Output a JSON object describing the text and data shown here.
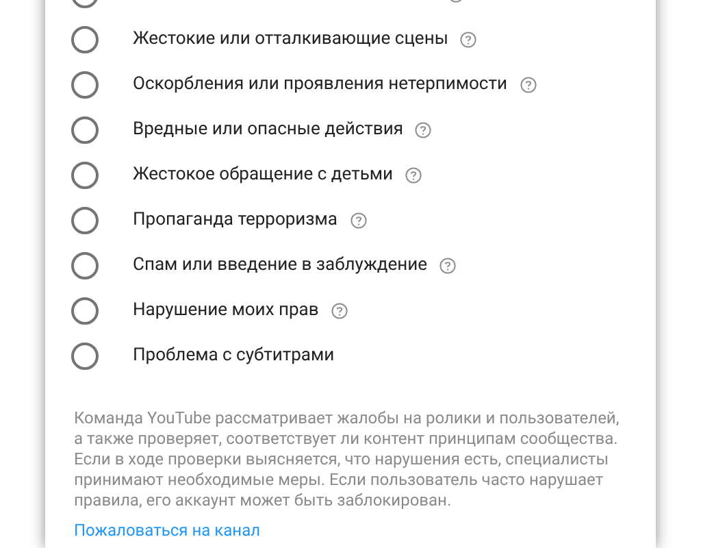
{
  "options": [
    {
      "selected": false,
      "help": true
    },
    {
      "label": "Жестокие или отталкивающие сцены",
      "selected": false,
      "help": true
    },
    {
      "label": "Оскорбления или проявления нетерпимости",
      "selected": false,
      "help": true
    },
    {
      "label": "Вредные или опасные действия",
      "selected": false,
      "help": true
    },
    {
      "label": "Жестокое обращение с детьми",
      "selected": false,
      "help": true
    },
    {
      "label": "Пропаганда терроризма",
      "selected": false,
      "help": true
    },
    {
      "label": "Спам или введение в заблуждение",
      "selected": false,
      "help": true
    },
    {
      "label": "Нарушение моих прав",
      "selected": false,
      "help": true
    },
    {
      "label": "Проблема с субтитрами",
      "selected": false,
      "help": false
    }
  ],
  "notice": "Команда YouTube рассматривает жалобы на ролики и пользователей, а также проверяет, соответствует ли контент принципам сообщества. Если в ходе проверки выясняется, что нарушения есть, специалисты принимают необходимые меры. Если пользователь часто нарушает правила, его аккаунт может быть заблокирован.",
  "link": "Пожаловаться на канал"
}
